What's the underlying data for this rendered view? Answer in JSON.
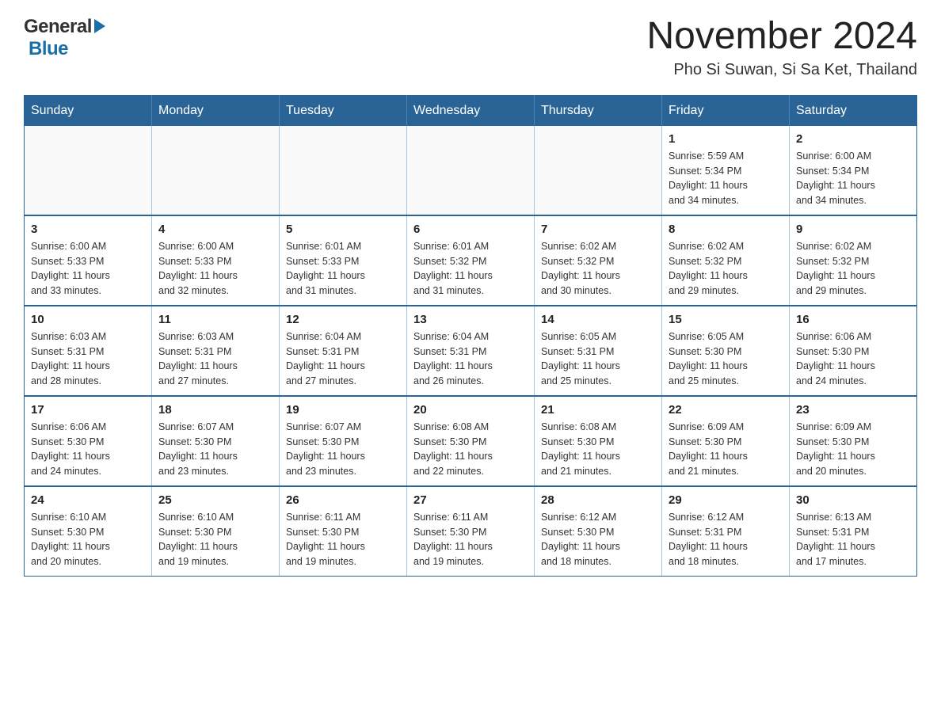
{
  "header": {
    "logo_general": "General",
    "logo_blue": "Blue",
    "title": "November 2024",
    "subtitle": "Pho Si Suwan, Si Sa Ket, Thailand"
  },
  "calendar": {
    "days_of_week": [
      "Sunday",
      "Monday",
      "Tuesday",
      "Wednesday",
      "Thursday",
      "Friday",
      "Saturday"
    ],
    "weeks": [
      [
        {
          "day": "",
          "info": ""
        },
        {
          "day": "",
          "info": ""
        },
        {
          "day": "",
          "info": ""
        },
        {
          "day": "",
          "info": ""
        },
        {
          "day": "",
          "info": ""
        },
        {
          "day": "1",
          "info": "Sunrise: 5:59 AM\nSunset: 5:34 PM\nDaylight: 11 hours\nand 34 minutes."
        },
        {
          "day": "2",
          "info": "Sunrise: 6:00 AM\nSunset: 5:34 PM\nDaylight: 11 hours\nand 34 minutes."
        }
      ],
      [
        {
          "day": "3",
          "info": "Sunrise: 6:00 AM\nSunset: 5:33 PM\nDaylight: 11 hours\nand 33 minutes."
        },
        {
          "day": "4",
          "info": "Sunrise: 6:00 AM\nSunset: 5:33 PM\nDaylight: 11 hours\nand 32 minutes."
        },
        {
          "day": "5",
          "info": "Sunrise: 6:01 AM\nSunset: 5:33 PM\nDaylight: 11 hours\nand 31 minutes."
        },
        {
          "day": "6",
          "info": "Sunrise: 6:01 AM\nSunset: 5:32 PM\nDaylight: 11 hours\nand 31 minutes."
        },
        {
          "day": "7",
          "info": "Sunrise: 6:02 AM\nSunset: 5:32 PM\nDaylight: 11 hours\nand 30 minutes."
        },
        {
          "day": "8",
          "info": "Sunrise: 6:02 AM\nSunset: 5:32 PM\nDaylight: 11 hours\nand 29 minutes."
        },
        {
          "day": "9",
          "info": "Sunrise: 6:02 AM\nSunset: 5:32 PM\nDaylight: 11 hours\nand 29 minutes."
        }
      ],
      [
        {
          "day": "10",
          "info": "Sunrise: 6:03 AM\nSunset: 5:31 PM\nDaylight: 11 hours\nand 28 minutes."
        },
        {
          "day": "11",
          "info": "Sunrise: 6:03 AM\nSunset: 5:31 PM\nDaylight: 11 hours\nand 27 minutes."
        },
        {
          "day": "12",
          "info": "Sunrise: 6:04 AM\nSunset: 5:31 PM\nDaylight: 11 hours\nand 27 minutes."
        },
        {
          "day": "13",
          "info": "Sunrise: 6:04 AM\nSunset: 5:31 PM\nDaylight: 11 hours\nand 26 minutes."
        },
        {
          "day": "14",
          "info": "Sunrise: 6:05 AM\nSunset: 5:31 PM\nDaylight: 11 hours\nand 25 minutes."
        },
        {
          "day": "15",
          "info": "Sunrise: 6:05 AM\nSunset: 5:30 PM\nDaylight: 11 hours\nand 25 minutes."
        },
        {
          "day": "16",
          "info": "Sunrise: 6:06 AM\nSunset: 5:30 PM\nDaylight: 11 hours\nand 24 minutes."
        }
      ],
      [
        {
          "day": "17",
          "info": "Sunrise: 6:06 AM\nSunset: 5:30 PM\nDaylight: 11 hours\nand 24 minutes."
        },
        {
          "day": "18",
          "info": "Sunrise: 6:07 AM\nSunset: 5:30 PM\nDaylight: 11 hours\nand 23 minutes."
        },
        {
          "day": "19",
          "info": "Sunrise: 6:07 AM\nSunset: 5:30 PM\nDaylight: 11 hours\nand 23 minutes."
        },
        {
          "day": "20",
          "info": "Sunrise: 6:08 AM\nSunset: 5:30 PM\nDaylight: 11 hours\nand 22 minutes."
        },
        {
          "day": "21",
          "info": "Sunrise: 6:08 AM\nSunset: 5:30 PM\nDaylight: 11 hours\nand 21 minutes."
        },
        {
          "day": "22",
          "info": "Sunrise: 6:09 AM\nSunset: 5:30 PM\nDaylight: 11 hours\nand 21 minutes."
        },
        {
          "day": "23",
          "info": "Sunrise: 6:09 AM\nSunset: 5:30 PM\nDaylight: 11 hours\nand 20 minutes."
        }
      ],
      [
        {
          "day": "24",
          "info": "Sunrise: 6:10 AM\nSunset: 5:30 PM\nDaylight: 11 hours\nand 20 minutes."
        },
        {
          "day": "25",
          "info": "Sunrise: 6:10 AM\nSunset: 5:30 PM\nDaylight: 11 hours\nand 19 minutes."
        },
        {
          "day": "26",
          "info": "Sunrise: 6:11 AM\nSunset: 5:30 PM\nDaylight: 11 hours\nand 19 minutes."
        },
        {
          "day": "27",
          "info": "Sunrise: 6:11 AM\nSunset: 5:30 PM\nDaylight: 11 hours\nand 19 minutes."
        },
        {
          "day": "28",
          "info": "Sunrise: 6:12 AM\nSunset: 5:30 PM\nDaylight: 11 hours\nand 18 minutes."
        },
        {
          "day": "29",
          "info": "Sunrise: 6:12 AM\nSunset: 5:31 PM\nDaylight: 11 hours\nand 18 minutes."
        },
        {
          "day": "30",
          "info": "Sunrise: 6:13 AM\nSunset: 5:31 PM\nDaylight: 11 hours\nand 17 minutes."
        }
      ]
    ]
  }
}
